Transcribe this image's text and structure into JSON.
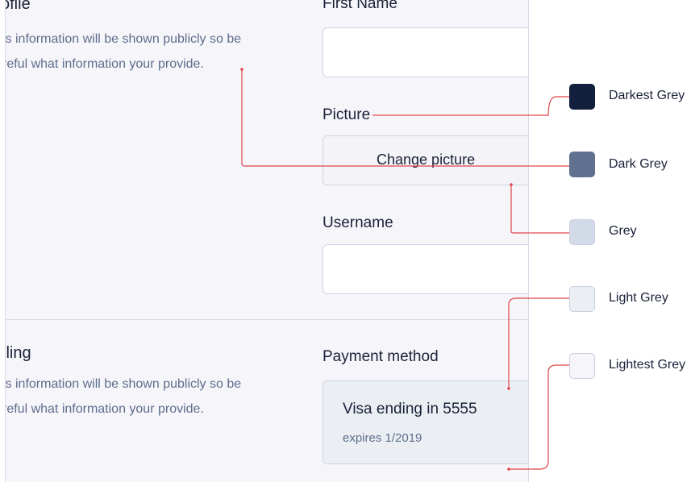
{
  "profile": {
    "title": "ofile",
    "desc_line1": "is information will be shown publicly so be",
    "desc_line2": "reful what information your provide.",
    "first_name_label": "First Name",
    "first_name_value": "",
    "picture_label": "Picture",
    "change_picture_label": "Change picture",
    "username_label": "Username",
    "username_value": ""
  },
  "billing": {
    "title": "lling",
    "desc_line1": "is information will be shown publicly so be",
    "desc_line2": "reful what information your provide.",
    "payment_label": "Payment method",
    "card_title": "Visa ending in 5555",
    "card_expiry": "expires 1/2019"
  },
  "palette": [
    {
      "name": "Darkest Grey",
      "color": "#13203d"
    },
    {
      "name": "Dark Grey",
      "color": "#60718f"
    },
    {
      "name": "Grey",
      "color": "#d2dae7"
    },
    {
      "name": "Light Grey",
      "color": "#ebeff3"
    },
    {
      "name": "Lightest Grey",
      "color": "#f6f5fa"
    }
  ],
  "annotation_line_color": "#e0464b"
}
